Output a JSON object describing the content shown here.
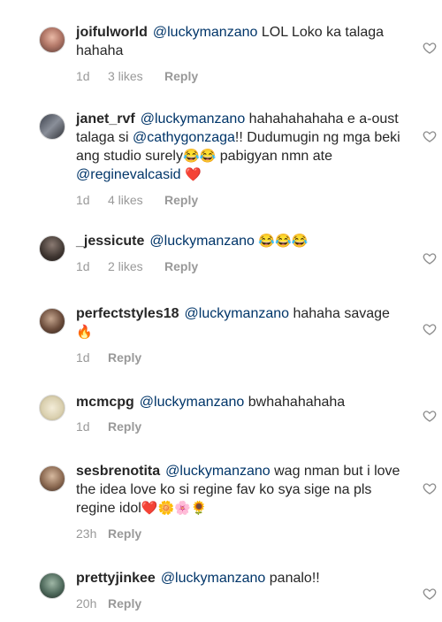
{
  "colors": {
    "mention": "#003569",
    "meta": "#999999",
    "text": "#262626"
  },
  "comments": [
    {
      "username": "joifulworld",
      "mention": "@luckymanzano",
      "text": "LOL Loko ka talaga hahaha",
      "time": "1d",
      "likes": "3 likes",
      "reply": "Reply"
    },
    {
      "username": "janet_rvf",
      "mention": "@luckymanzano",
      "text": "hahahahahaha e a-oust talaga si",
      "mention2": "@cathygonzaga",
      "text2": "!! Dudumugin ng mga beki ang studio surely",
      "emoji": "😂😂",
      "text3": "pabigyan nmn ate",
      "mention3": "@reginevalcasid",
      "emoji2": "❤️",
      "time": "1d",
      "likes": "4 likes",
      "reply": "Reply"
    },
    {
      "username": "_jessicute",
      "mention": "@luckymanzano",
      "emoji": "😂😂😂",
      "time": "1d",
      "likes": "2 likes",
      "reply": "Reply"
    },
    {
      "username": "perfectstyles18",
      "mention": "@luckymanzano",
      "text": "hahaha savage",
      "emoji": "🔥",
      "time": "1d",
      "reply": "Reply"
    },
    {
      "username": "mcmcpg",
      "mention": "@luckymanzano",
      "text": "bwhahahahaha",
      "time": "1d",
      "reply": "Reply"
    },
    {
      "username": "sesbrenotita",
      "mention": "@luckymanzano",
      "text": "wag nman but i love the idea love ko si regine fav ko sya sige na pls regine idol",
      "emoji": "❤️🌼🌸🌻",
      "time": "23h",
      "reply": "Reply"
    },
    {
      "username": "prettyjinkee",
      "mention": "@luckymanzano",
      "text": "panalo!!",
      "time": "20h",
      "reply": "Reply"
    }
  ]
}
